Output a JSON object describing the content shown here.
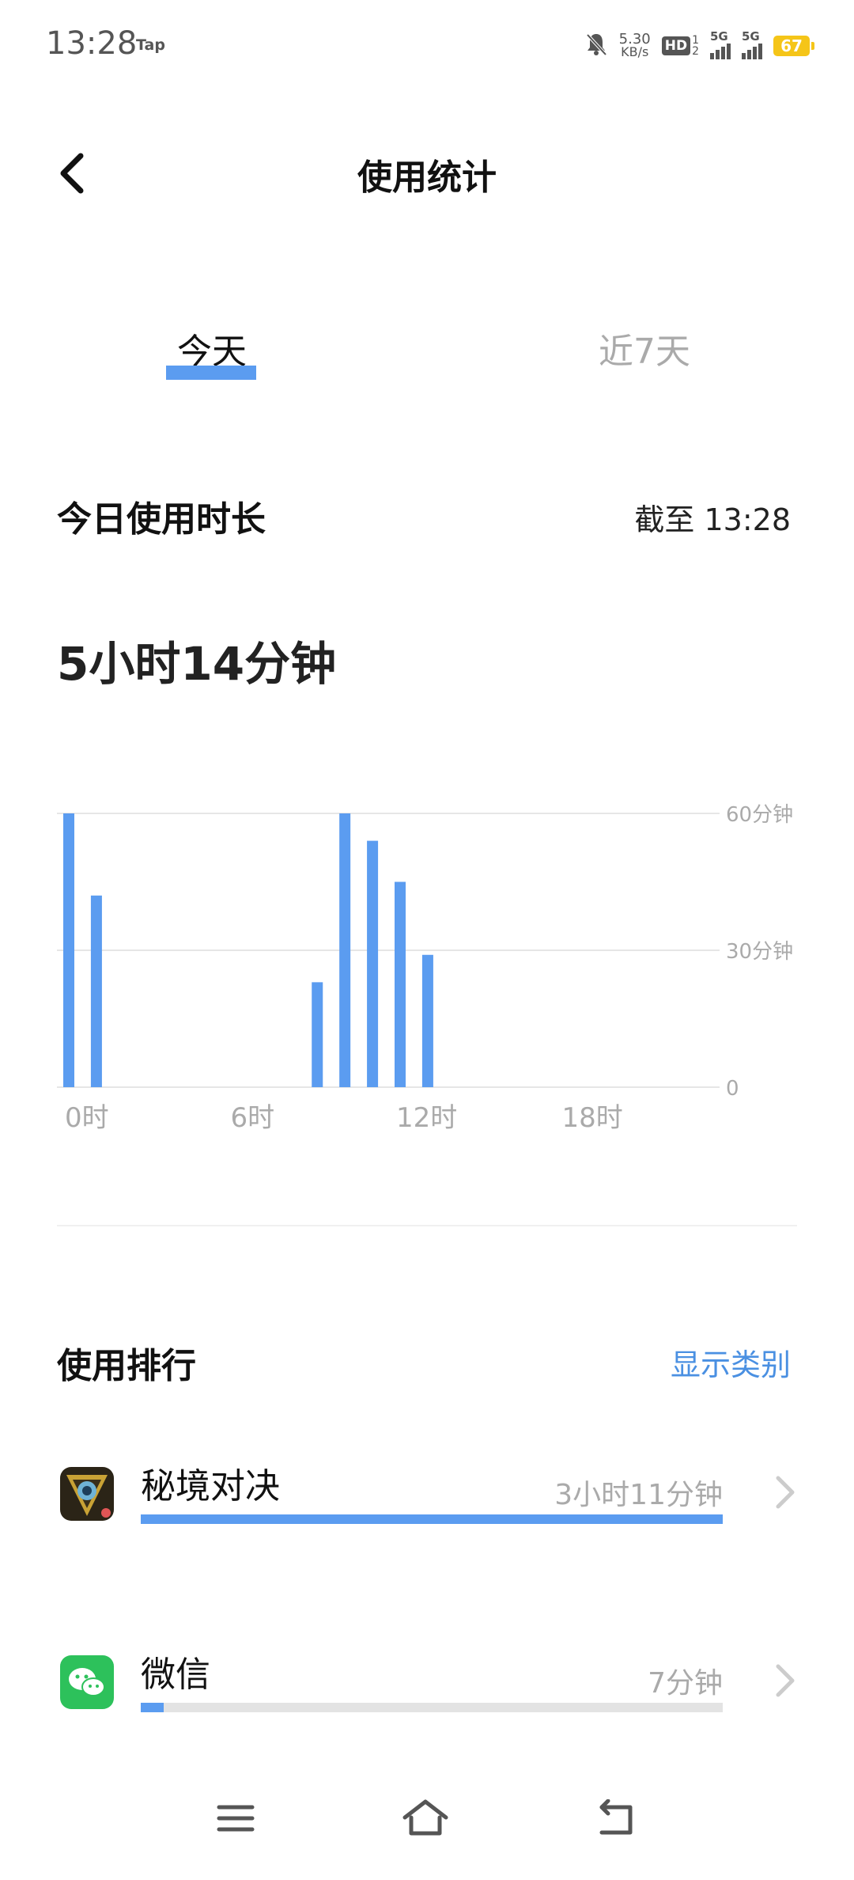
{
  "status_bar": {
    "time": "13:28",
    "tap_label": "Tap",
    "net_speed_value": "5.30",
    "net_speed_unit": "KB/s",
    "hd_label": "HD",
    "hd_sub_top": "1",
    "hd_sub_bottom": "2",
    "signal1_label": "5G",
    "signal2_label": "5G",
    "battery_level": "67",
    "icons": [
      "bell-muted-icon",
      "signal-icon",
      "battery-icon"
    ]
  },
  "header": {
    "title": "使用统计",
    "back_icon": "chevron-left-icon"
  },
  "tabs": [
    {
      "label": "今天",
      "active": true
    },
    {
      "label": "近7天",
      "active": false
    }
  ],
  "today_usage": {
    "title": "今日使用时长",
    "as_of": "截至 13:28",
    "total": "5小时14分钟"
  },
  "chart_data": {
    "type": "bar",
    "x_unit": "hour",
    "hours": [
      0,
      1,
      9,
      10,
      11,
      12,
      13
    ],
    "values": [
      60,
      42,
      23,
      60,
      54,
      45,
      29
    ],
    "ylim": [
      0,
      60
    ],
    "y_ticks": [
      "0",
      "30分钟",
      "60分钟"
    ],
    "x_ticks": [
      "0时",
      "6时",
      "12时",
      "18时"
    ],
    "grid": true,
    "color": "#5b9cf0"
  },
  "ranking": {
    "title": "使用排行",
    "show_category_label": "显示类别",
    "apps": [
      {
        "name": "秘境对决",
        "time": "3小时11分钟",
        "share": 1.0,
        "icon": "game-app-icon"
      },
      {
        "name": "微信",
        "time": "7分钟",
        "share": 0.04,
        "icon": "wechat-icon"
      }
    ]
  },
  "nav": {
    "icons": [
      "menu-icon",
      "home-icon",
      "back-icon"
    ]
  },
  "colors": {
    "accent": "#5b9cf0",
    "link": "#4a90e2",
    "muted": "#aaaaaa"
  }
}
